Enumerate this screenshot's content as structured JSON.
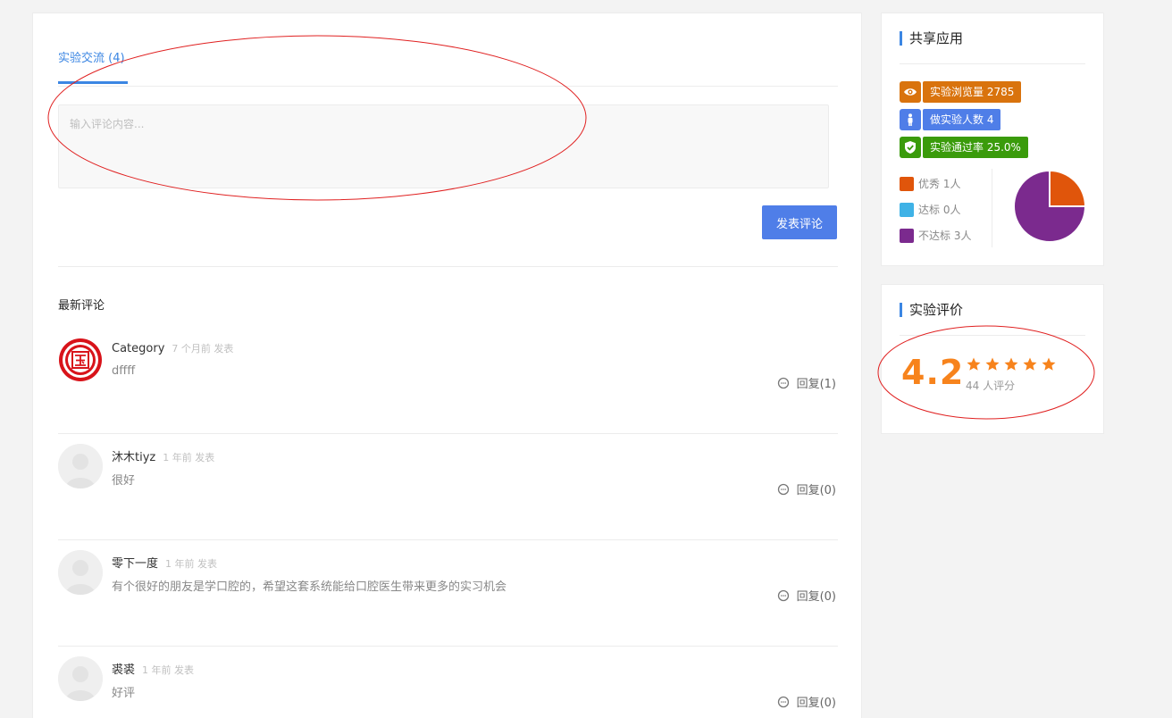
{
  "tab": {
    "label": "实验交流 (4)"
  },
  "comment_input": {
    "placeholder": "输入评论内容..."
  },
  "submit_label": "发表评论",
  "latest_title": "最新评论",
  "comments": [
    {
      "user": "Category",
      "time": "7 个月前 发表",
      "text": "dffff",
      "reply": "回复(1)",
      "avatar": "seal-avatar"
    },
    {
      "user": "沐木tiyz",
      "time": "1 年前 发表",
      "text": "很好",
      "reply": "回复(0)",
      "avatar": "default-avatar"
    },
    {
      "user": "零下一度",
      "time": "1 年前 发表",
      "text": "有个很好的朋友是学口腔的，希望这套系统能给口腔医生带来更多的实习机会",
      "reply": "回复(0)",
      "avatar": "default-avatar"
    },
    {
      "user": "裘裘",
      "time": "1 年前 发表",
      "text": "好评",
      "reply": "回复(0)",
      "avatar": "default-avatar"
    }
  ],
  "share": {
    "title": "共享应用",
    "badges": [
      {
        "label": "实验浏览量 2785",
        "icon": "eye-icon",
        "color": "#d9730d"
      },
      {
        "label": "做实验人数 4",
        "icon": "person-icon",
        "color": "#4f7ee8"
      },
      {
        "label": "实验通过率 25.0%",
        "icon": "shield-check-icon",
        "color": "#3a9b0b"
      }
    ],
    "legend": [
      {
        "label": "优秀 1人",
        "color": "#e0550b"
      },
      {
        "label": "达标 0人",
        "color": "#3fb2e6"
      },
      {
        "label": "不达标 3人",
        "color": "#7b2a8e"
      }
    ],
    "chart_data": {
      "type": "pie",
      "categories": [
        "优秀",
        "达标",
        "不达标"
      ],
      "values": [
        1,
        0,
        3
      ],
      "colors": [
        "#e0550b",
        "#3fb2e6",
        "#7b2a8e"
      ]
    }
  },
  "rating": {
    "title": "实验评价",
    "score": "4.2",
    "stars": 5,
    "count_label": "44 人评分",
    "star_color": "#f7831c"
  }
}
